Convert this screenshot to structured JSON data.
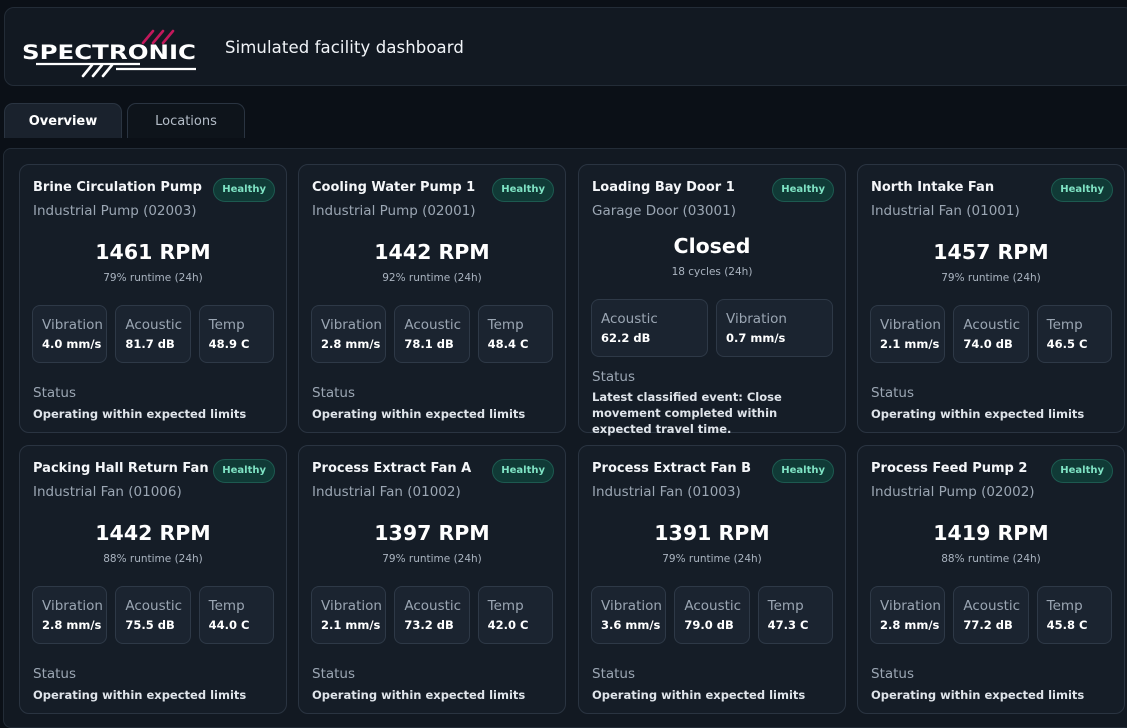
{
  "header": {
    "brand": "SPECTRONIC",
    "title": "Simulated facility dashboard"
  },
  "tabs": [
    {
      "label": "Overview"
    },
    {
      "label": "Locations"
    }
  ],
  "cards": [
    {
      "name": "Brine Circulation Pump",
      "type": "Industrial Pump (02003)",
      "badge": "Healthy",
      "metric": "1461 RPM",
      "sub": "79% runtime (24h)",
      "tiles": [
        {
          "label": "Vibration",
          "value": "4.0 mm/s"
        },
        {
          "label": "Acoustic",
          "value": "81.7 dB"
        },
        {
          "label": "Temp",
          "value": "48.9 C"
        }
      ],
      "status_label": "Status",
      "status": "Operating within expected limits"
    },
    {
      "name": "Cooling Water Pump 1",
      "type": "Industrial Pump (02001)",
      "badge": "Healthy",
      "metric": "1442 RPM",
      "sub": "92% runtime (24h)",
      "tiles": [
        {
          "label": "Vibration",
          "value": "2.8 mm/s"
        },
        {
          "label": "Acoustic",
          "value": "78.1 dB"
        },
        {
          "label": "Temp",
          "value": "48.4 C"
        }
      ],
      "status_label": "Status",
      "status": "Operating within expected limits"
    },
    {
      "name": "Loading Bay Door 1",
      "type": "Garage Door (03001)",
      "badge": "Healthy",
      "metric": "Closed",
      "sub": "18 cycles (24h)",
      "tiles": [
        {
          "label": "Acoustic",
          "value": "62.2 dB"
        },
        {
          "label": "Vibration",
          "value": "0.7 mm/s"
        }
      ],
      "status_label": "Status",
      "status": "Latest classified event: Close movement completed within expected travel time."
    },
    {
      "name": "North Intake Fan",
      "type": "Industrial Fan (01001)",
      "badge": "Healthy",
      "metric": "1457 RPM",
      "sub": "79% runtime (24h)",
      "tiles": [
        {
          "label": "Vibration",
          "value": "2.1 mm/s"
        },
        {
          "label": "Acoustic",
          "value": "74.0 dB"
        },
        {
          "label": "Temp",
          "value": "46.5 C"
        }
      ],
      "status_label": "Status",
      "status": "Operating within expected limits"
    },
    {
      "name": "Packing Hall Return Fan",
      "type": "Industrial Fan (01006)",
      "badge": "Healthy",
      "metric": "1442 RPM",
      "sub": "88% runtime (24h)",
      "tiles": [
        {
          "label": "Vibration",
          "value": "2.8 mm/s"
        },
        {
          "label": "Acoustic",
          "value": "75.5 dB"
        },
        {
          "label": "Temp",
          "value": "44.0 C"
        }
      ],
      "status_label": "Status",
      "status": "Operating within expected limits"
    },
    {
      "name": "Process Extract Fan A",
      "type": "Industrial Fan (01002)",
      "badge": "Healthy",
      "metric": "1397 RPM",
      "sub": "79% runtime (24h)",
      "tiles": [
        {
          "label": "Vibration",
          "value": "2.1 mm/s"
        },
        {
          "label": "Acoustic",
          "value": "73.2 dB"
        },
        {
          "label": "Temp",
          "value": "42.0 C"
        }
      ],
      "status_label": "Status",
      "status": "Operating within expected limits"
    },
    {
      "name": "Process Extract Fan B",
      "type": "Industrial Fan (01003)",
      "badge": "Healthy",
      "metric": "1391 RPM",
      "sub": "79% runtime (24h)",
      "tiles": [
        {
          "label": "Vibration",
          "value": "3.6 mm/s"
        },
        {
          "label": "Acoustic",
          "value": "79.0 dB"
        },
        {
          "label": "Temp",
          "value": "47.3 C"
        }
      ],
      "status_label": "Status",
      "status": "Operating within expected limits"
    },
    {
      "name": "Process Feed Pump 2",
      "type": "Industrial Pump (02002)",
      "badge": "Healthy",
      "metric": "1419 RPM",
      "sub": "88% runtime (24h)",
      "tiles": [
        {
          "label": "Vibration",
          "value": "2.8 mm/s"
        },
        {
          "label": "Acoustic",
          "value": "77.2 dB"
        },
        {
          "label": "Temp",
          "value": "45.8 C"
        }
      ],
      "status_label": "Status",
      "status": "Operating within expected limits"
    }
  ],
  "colors": {
    "accent": "#c2185b",
    "healthy": "#7fe3c4",
    "background": "#0b1017",
    "card": "#151d27"
  }
}
